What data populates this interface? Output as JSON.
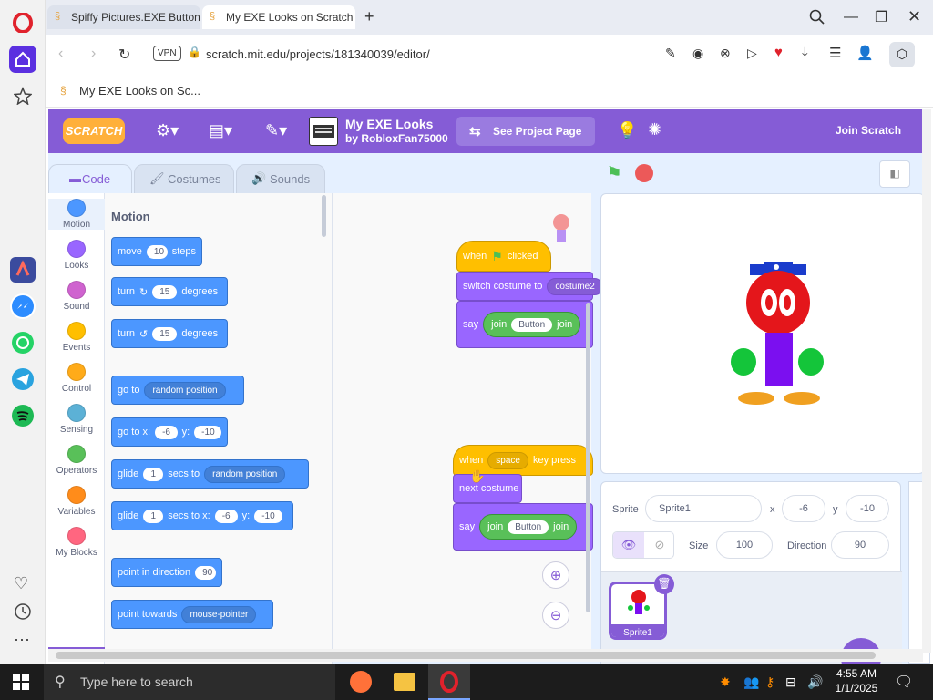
{
  "browser": {
    "tabs": [
      {
        "label": "Spiffy Pictures.EXE Button"
      },
      {
        "label": "My EXE Looks on Scratch"
      }
    ],
    "vpn_label": "VPN",
    "url": "scratch.mit.edu/projects/181340039/editor/",
    "bookmark_label": "My EXE Looks on Sc..."
  },
  "scratch": {
    "logo": "SCRATCH",
    "project_title": "My EXE Looks",
    "author": "by RobloxFan75000",
    "see_project_page": "See Project Page",
    "join": "Join Scratch",
    "tabs": {
      "code": "Code",
      "costumes": "Costumes",
      "sounds": "Sounds"
    },
    "categories": [
      {
        "label": "Motion",
        "color": "#4c97ff"
      },
      {
        "label": "Looks",
        "color": "#9966ff"
      },
      {
        "label": "Sound",
        "color": "#cf63cf"
      },
      {
        "label": "Events",
        "color": "#ffbf00"
      },
      {
        "label": "Control",
        "color": "#ffab19"
      },
      {
        "label": "Sensing",
        "color": "#5cb1d6"
      },
      {
        "label": "Operators",
        "color": "#59c059"
      },
      {
        "label": "Variables",
        "color": "#ff8c1a"
      },
      {
        "label": "My Blocks",
        "color": "#ff6680"
      }
    ],
    "palette": {
      "heading": "Motion",
      "move": {
        "a": "move",
        "v": "10",
        "b": "steps"
      },
      "turn_right": {
        "a": "turn",
        "v": "15",
        "b": "degrees"
      },
      "turn_left": {
        "a": "turn",
        "v": "15",
        "b": "degrees"
      },
      "goto": {
        "a": "go to",
        "dd": "random position"
      },
      "goto_xy": {
        "a": "go to x:",
        "x": "-6",
        "b": "y:",
        "y": "-10"
      },
      "glide": {
        "a": "glide",
        "v": "1",
        "b": "secs to",
        "dd": "random position"
      },
      "glide_xy": {
        "a": "glide",
        "v": "1",
        "b": "secs to x:",
        "x": "-6",
        "c": "y:",
        "y": "-10"
      },
      "point_dir": {
        "a": "point in direction",
        "v": "90"
      },
      "point_towards": {
        "a": "point towards",
        "dd": "mouse-pointer"
      }
    },
    "script1": {
      "hat_a": "when",
      "hat_b": "clicked",
      "switch": "switch costume to",
      "costume": "costume2",
      "say": "say",
      "join": "join",
      "button": "Button",
      "join2": "join"
    },
    "script2": {
      "hat_a": "when",
      "key": "space",
      "hat_b": "key press",
      "next": "next costume",
      "say": "say",
      "join": "join",
      "button": "Button",
      "join2": "join"
    },
    "sprite_info": {
      "sprite_label": "Sprite",
      "sprite_name": "Sprite1",
      "x_label": "x",
      "x": "-6",
      "y_label": "y",
      "y": "-10",
      "size_label": "Size",
      "size": "100",
      "dir_label": "Direction",
      "dir": "90"
    },
    "sprite_thumb": "Sprite1"
  },
  "taskbar": {
    "search_placeholder": "Type here to search",
    "time": "4:55 AM",
    "date": "1/1/2025"
  }
}
